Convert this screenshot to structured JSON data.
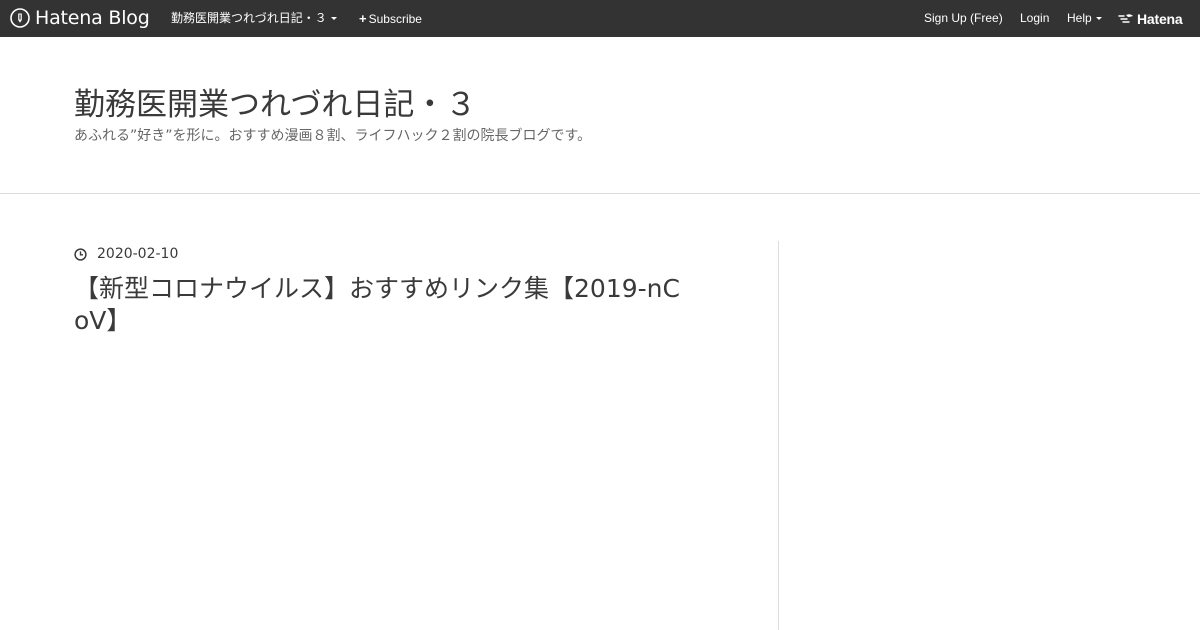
{
  "globalheader": {
    "logo_text": "Hatena Blog",
    "blog_name": "勤務医開業つれづれ日記・３",
    "subscribe_label": "Subscribe",
    "signup_label": "Sign Up (Free)",
    "login_label": "Login",
    "help_label": "Help",
    "hatena_label": "Hatena"
  },
  "blog": {
    "title": "勤務医開業つれづれ日記・３",
    "description": "あふれる”好き”を形に。おすすめ漫画８割、ライフハック２割の院長ブログです。"
  },
  "entry": {
    "date": "2020-02-10",
    "title": "【新型コロナウイルス】おすすめリンク集【2019-nCoV】"
  },
  "colors": {
    "header_bg": "#333333",
    "text": "#3a3a3a",
    "divider": "#dddddd"
  },
  "icons": {
    "logo": "hatena-blog-pen-icon",
    "date": "clock-icon",
    "hatena": "hatena-bird-icon"
  }
}
